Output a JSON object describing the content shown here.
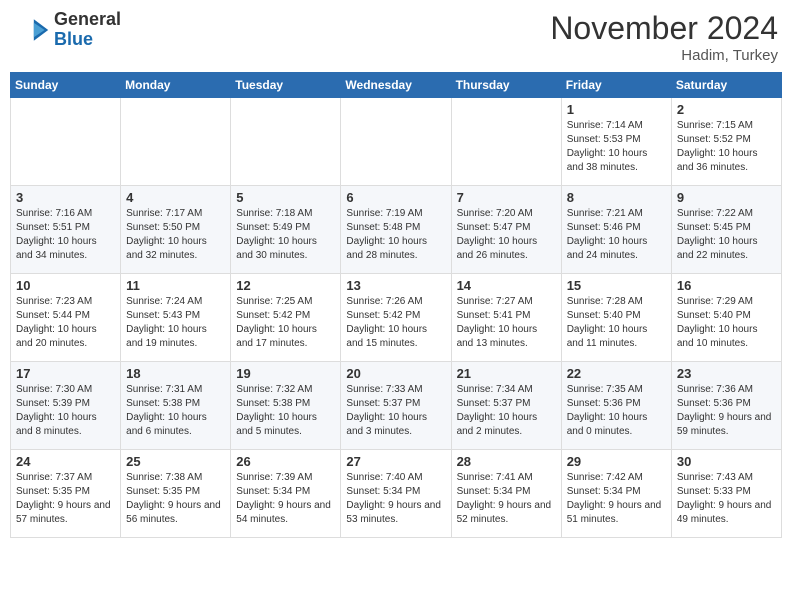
{
  "header": {
    "logo_line1": "General",
    "logo_line2": "Blue",
    "month": "November 2024",
    "location": "Hadim, Turkey"
  },
  "weekdays": [
    "Sunday",
    "Monday",
    "Tuesday",
    "Wednesday",
    "Thursday",
    "Friday",
    "Saturday"
  ],
  "weeks": [
    [
      {
        "day": "",
        "info": ""
      },
      {
        "day": "",
        "info": ""
      },
      {
        "day": "",
        "info": ""
      },
      {
        "day": "",
        "info": ""
      },
      {
        "day": "",
        "info": ""
      },
      {
        "day": "1",
        "info": "Sunrise: 7:14 AM\nSunset: 5:53 PM\nDaylight: 10 hours and 38 minutes."
      },
      {
        "day": "2",
        "info": "Sunrise: 7:15 AM\nSunset: 5:52 PM\nDaylight: 10 hours and 36 minutes."
      }
    ],
    [
      {
        "day": "3",
        "info": "Sunrise: 7:16 AM\nSunset: 5:51 PM\nDaylight: 10 hours and 34 minutes."
      },
      {
        "day": "4",
        "info": "Sunrise: 7:17 AM\nSunset: 5:50 PM\nDaylight: 10 hours and 32 minutes."
      },
      {
        "day": "5",
        "info": "Sunrise: 7:18 AM\nSunset: 5:49 PM\nDaylight: 10 hours and 30 minutes."
      },
      {
        "day": "6",
        "info": "Sunrise: 7:19 AM\nSunset: 5:48 PM\nDaylight: 10 hours and 28 minutes."
      },
      {
        "day": "7",
        "info": "Sunrise: 7:20 AM\nSunset: 5:47 PM\nDaylight: 10 hours and 26 minutes."
      },
      {
        "day": "8",
        "info": "Sunrise: 7:21 AM\nSunset: 5:46 PM\nDaylight: 10 hours and 24 minutes."
      },
      {
        "day": "9",
        "info": "Sunrise: 7:22 AM\nSunset: 5:45 PM\nDaylight: 10 hours and 22 minutes."
      }
    ],
    [
      {
        "day": "10",
        "info": "Sunrise: 7:23 AM\nSunset: 5:44 PM\nDaylight: 10 hours and 20 minutes."
      },
      {
        "day": "11",
        "info": "Sunrise: 7:24 AM\nSunset: 5:43 PM\nDaylight: 10 hours and 19 minutes."
      },
      {
        "day": "12",
        "info": "Sunrise: 7:25 AM\nSunset: 5:42 PM\nDaylight: 10 hours and 17 minutes."
      },
      {
        "day": "13",
        "info": "Sunrise: 7:26 AM\nSunset: 5:42 PM\nDaylight: 10 hours and 15 minutes."
      },
      {
        "day": "14",
        "info": "Sunrise: 7:27 AM\nSunset: 5:41 PM\nDaylight: 10 hours and 13 minutes."
      },
      {
        "day": "15",
        "info": "Sunrise: 7:28 AM\nSunset: 5:40 PM\nDaylight: 10 hours and 11 minutes."
      },
      {
        "day": "16",
        "info": "Sunrise: 7:29 AM\nSunset: 5:40 PM\nDaylight: 10 hours and 10 minutes."
      }
    ],
    [
      {
        "day": "17",
        "info": "Sunrise: 7:30 AM\nSunset: 5:39 PM\nDaylight: 10 hours and 8 minutes."
      },
      {
        "day": "18",
        "info": "Sunrise: 7:31 AM\nSunset: 5:38 PM\nDaylight: 10 hours and 6 minutes."
      },
      {
        "day": "19",
        "info": "Sunrise: 7:32 AM\nSunset: 5:38 PM\nDaylight: 10 hours and 5 minutes."
      },
      {
        "day": "20",
        "info": "Sunrise: 7:33 AM\nSunset: 5:37 PM\nDaylight: 10 hours and 3 minutes."
      },
      {
        "day": "21",
        "info": "Sunrise: 7:34 AM\nSunset: 5:37 PM\nDaylight: 10 hours and 2 minutes."
      },
      {
        "day": "22",
        "info": "Sunrise: 7:35 AM\nSunset: 5:36 PM\nDaylight: 10 hours and 0 minutes."
      },
      {
        "day": "23",
        "info": "Sunrise: 7:36 AM\nSunset: 5:36 PM\nDaylight: 9 hours and 59 minutes."
      }
    ],
    [
      {
        "day": "24",
        "info": "Sunrise: 7:37 AM\nSunset: 5:35 PM\nDaylight: 9 hours and 57 minutes."
      },
      {
        "day": "25",
        "info": "Sunrise: 7:38 AM\nSunset: 5:35 PM\nDaylight: 9 hours and 56 minutes."
      },
      {
        "day": "26",
        "info": "Sunrise: 7:39 AM\nSunset: 5:34 PM\nDaylight: 9 hours and 54 minutes."
      },
      {
        "day": "27",
        "info": "Sunrise: 7:40 AM\nSunset: 5:34 PM\nDaylight: 9 hours and 53 minutes."
      },
      {
        "day": "28",
        "info": "Sunrise: 7:41 AM\nSunset: 5:34 PM\nDaylight: 9 hours and 52 minutes."
      },
      {
        "day": "29",
        "info": "Sunrise: 7:42 AM\nSunset: 5:34 PM\nDaylight: 9 hours and 51 minutes."
      },
      {
        "day": "30",
        "info": "Sunrise: 7:43 AM\nSunset: 5:33 PM\nDaylight: 9 hours and 49 minutes."
      }
    ]
  ]
}
